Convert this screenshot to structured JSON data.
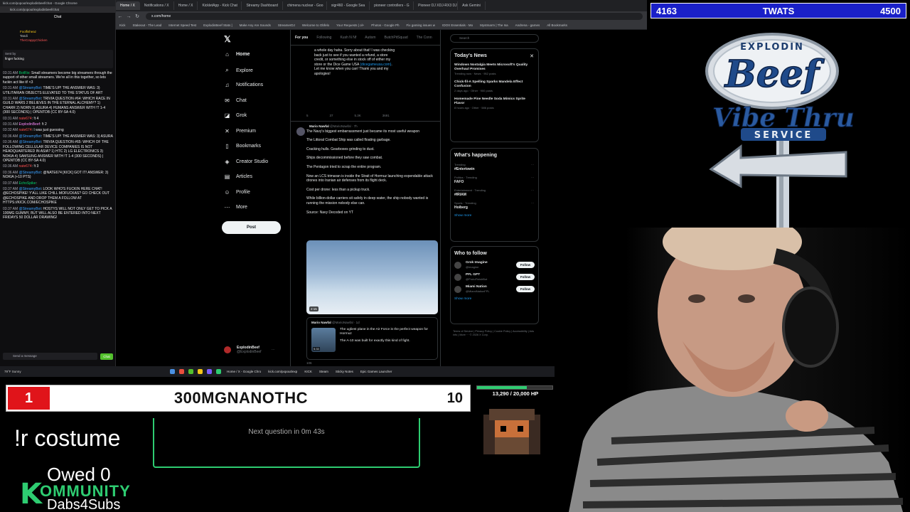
{
  "chat_window": {
    "title": "kick.com/popout/explodinbeef/chat - Google Chrome",
    "url": "kick.com/popout/explodinbeef/chat",
    "heading": "Chat",
    "leaderboard": [
      "Foolfisheaz",
      "Tandi",
      "TheCrappyChicken"
    ],
    "pinned_by": "Sent by",
    "pinned_text": "finger fucking",
    "messages": [
      {
        "time": "03:31 AM",
        "user": "BotRix",
        "text": "Small streamers become big streamers through the support of other small streamers. We're all in this together, so lets fuckin act like it! <3"
      },
      {
        "time": "03:31 AM",
        "user": "@StreamyBot",
        "text": "TIME'S UP! THE ANSWER WAS: 3) UTILITARIAN OBJECTS ELEVATED TO THE STATUS OF ART"
      },
      {
        "time": "03:31 AM",
        "user": "@StreamyBot",
        "text": "TRIVIA QUESTION #64: WHICH RACE IN GUILD WARS 2 BELIEVES IN THE ETERNAL ALCHEMY? 1) CHARR 2) NORN 3) ASURA 4) HUMANS ANSWER WITH !T 1-4 (300 SECONDS) | OPENTDB (CC BY-SA 4.0)"
      },
      {
        "time": "03:31 AM",
        "user": "nate674",
        "text": "!t 4"
      },
      {
        "time": "03:31 AM",
        "user": "ExplodinBeef",
        "text": "!t 2"
      },
      {
        "time": "03:32 AM",
        "user": "nate674",
        "text": "I was just guessing"
      },
      {
        "time": "03:36 AM",
        "user": "@StreamyBot",
        "text": "TIME'S UP! THE ANSWER WAS: 3) ASURA"
      },
      {
        "time": "03:36 AM",
        "user": "@StreamyBot",
        "text": "TRIVIA QUESTION #65: WHICH OF THE FOLLOWING CELLULAR DEVICE COMPANIES IS NOT HEADQUARTERED IN ASIA? 1) HTC 2) LG ELECTRONICS 3) NOKIA 4) SAMSUNG ANSWER WITH !T 1-4 (300 SECONDS) | OPENTDB (CC BY-SA 4.0)"
      },
      {
        "time": "03:36 AM",
        "user": "nate674",
        "text": "!t 3"
      },
      {
        "time": "03:36 AM",
        "user": "@StreamyBot",
        "text": "@NATE674 [KICK] GOT IT! ANSWER: 3) NOKIA (+10 PTS)"
      },
      {
        "time": "03:37 AM",
        "user": "EchoSpike",
        "text": ""
      },
      {
        "time": "03:37 AM",
        "user": "@StreamyBot",
        "text": "LOOK WHO'S FUCKIN HERE CHAT! @ECHOSPIKE! Y'ALL LIKE CHILL MOFUCKAS? GO CHECK OUT @ECHOSPIKE AND DROP THEM A FOLLOW AT HTTPS://KICK.COM/ECHOSPIKE"
      },
      {
        "time": "03:37 AM",
        "user": "@StreamyBot",
        "text": "HOSTYS WILL NOT ONLY GET TO PICK A 100MG GUMMY, BUT WILL ALSO BE ENTERED INTO NEXT FRIDAYS 50 DOLLAR DRAWING!"
      }
    ],
    "input_placeholder": "Send a message",
    "send_label": "Chat"
  },
  "browser": {
    "tabs": [
      "Home / X",
      "Notifications / X",
      "Home / X",
      "KickletApp - Kick Chat",
      "Streamy Dashboard",
      "chimena nuclear - Goo",
      "xigr460 - Google Sea",
      "pioneer controllers - G",
      "Pioneer DJ XDJ-RX3 DJ",
      "Ask Gemini"
    ],
    "url": "x.com/home",
    "bookmarks": [
      "Kick",
      "Stakeout - The Lead",
      "Internet Speed Test",
      "ExplodinBeef Stats |",
      "Make Any Are Sounds",
      "StreamerDJ",
      "Welcome to Obfelo",
      "Your Requests | ol+",
      "Photos - Google Ph",
      "Fix gaming issues w",
      "IDOX Essentials - Mo",
      "Mystmarm | The Isa",
      "Andrena - games",
      "All Bookmarks"
    ]
  },
  "x_nav": {
    "items": [
      {
        "label": "Home",
        "icon": "home-icon",
        "glyph": "⌂"
      },
      {
        "label": "Explore",
        "icon": "search-icon",
        "glyph": "⌕"
      },
      {
        "label": "Notifications",
        "icon": "bell-icon",
        "glyph": "♫"
      },
      {
        "label": "Chat",
        "icon": "chat-icon",
        "glyph": "✉"
      },
      {
        "label": "Grok",
        "icon": "grok-icon",
        "glyph": "◪"
      },
      {
        "label": "Premium",
        "icon": "x-premium-icon",
        "glyph": "✕"
      },
      {
        "label": "Bookmarks",
        "icon": "bookmark-icon",
        "glyph": "▯"
      },
      {
        "label": "Creator Studio",
        "icon": "creator-icon",
        "glyph": "◈"
      },
      {
        "label": "Articles",
        "icon": "articles-icon",
        "glyph": "▤"
      },
      {
        "label": "Profile",
        "icon": "profile-icon",
        "glyph": "☺"
      },
      {
        "label": "More",
        "icon": "more-icon",
        "glyph": "⋯"
      }
    ],
    "post_label": "Post",
    "account_name": "ExplodinBeef",
    "account_handle": "@ExplodinBeef"
  },
  "timeline": {
    "tabs": [
      "For you",
      "Following",
      "Kush N Nf",
      "Autism",
      "ButchPitSquad",
      "The Conn"
    ],
    "prev_text_a": "a whole day haha. Sorry about that! I was checking back just to see if you wanted a refund, a store credit, or something else in stock off of either my store or the Dice Game USA",
    "prev_link": "(dicegameusa.com)",
    "prev_text_b": ". Let me know when you can! Thank you and my apologies!",
    "prev_stats": [
      "5",
      "37",
      "5.3K",
      "3691"
    ],
    "tweet": {
      "author": "Mario Nawfal",
      "handle": "@MarioNawfal · 7h",
      "lines": [
        "The Navy's biggest embarrassment just became its most useful weapon",
        "The Littoral Combat Ship was called floating garbage.",
        "Cracking hulls. Gearboxes grinding to dust.",
        "Ships decommissioned before they saw combat.",
        "The Pentagon tried to scrap the entire program.",
        "Now an LCS trimaran is inside the Strait of Hormuz launching expendable attack drones into Iranian air defenses from its flight deck.",
        "Cost per drone: less than a pickup truck.",
        "While billion-dollar carriers sit safely in deep water, the ship nobody wanted is running the mission nobody else can.",
        "Source: Navy Decoded on YT"
      ],
      "video_duration": "2:15"
    },
    "quote": {
      "author": "Mario Nawfal",
      "handle": "@MarioNawfal · 1d",
      "text_a": "The ugliest plane in the Air Force is the perfect weapon for Hormuz",
      "text_b": "The A-10 was built for exactly this kind of fight.",
      "thumb_duration": "5:33"
    },
    "next_stats": [
      "106"
    ]
  },
  "right_col": {
    "search_placeholder": "Search",
    "news_title": "Today's News",
    "news": [
      {
        "title": "Windows Nostalgia Meets Microsoft's Quality Overhaul Promises",
        "meta": "Trending now · News · 952 posts"
      },
      {
        "title": "Chick-fil-A Spelling Sparks Mandela Effect Confusion",
        "meta": "2 days ago · Other · 900 posts"
      },
      {
        "title": "Homemade Pine Needle Soda Mimics Sprite Flavor",
        "meta": "8 hours ago · Other · 586 posts"
      }
    ],
    "happening_title": "What's happening",
    "trends": [
      {
        "context": "Trending",
        "name": "#Entertowin"
      },
      {
        "context": "Politics · Trending",
        "name": "FAFO"
      },
      {
        "context": "Entertainment · Trending",
        "name": "#IRIAM"
      },
      {
        "context": "Sports · Trending",
        "name": "Hoiberg"
      }
    ],
    "show_more": "Show more",
    "follow_title": "Who to follow",
    "follows": [
      {
        "name": "Grok Imagine",
        "handle": "@Imagine"
      },
      {
        "name": "PFL GPT",
        "handle": "@ProtoFinishBot"
      },
      {
        "name": "Miami Nation",
        "handle": "@MiamiNationFPL"
      }
    ],
    "follow_label": "Follow",
    "footer": "Terms of Service | Privacy Policy | Cookie Policy | Accessibility | Ads info | More ··· © 2026 X Corp."
  },
  "taskbar": {
    "weather": "79°F Sunny",
    "apps": [
      "Home / X - Google Chro",
      "kick.com/popout/exp",
      "KICK",
      "Steam",
      "Sticky Notes",
      "Epic Games Launcher"
    ],
    "time": "3:42 AM",
    "date": "3/22/2026"
  },
  "overlay": {
    "score_left": "4163",
    "score_center": "TWATS",
    "score_right": "4500",
    "logo_top": "EXPLODIN",
    "logo_mid": "Beef",
    "logo_vibe": "Vibe Thru",
    "logo_service": "SERVICE",
    "question_number": "1",
    "question_answer": "300MGNANOTHC",
    "question_timer": "10",
    "hp_text": "13,290 / 20,000 HP",
    "hp_fraction": 0.66,
    "next_question": "Next question in 0m 43s",
    "command": "!r costume",
    "owed": "Owed 0",
    "kommunity_k": "K",
    "kommunity_word": "OMMUNITY",
    "dabs": "Dabs4Subs"
  },
  "colors": {
    "score_bg": "#1a20c8",
    "question_red": "#e0141a",
    "accent_green": "#2ecc71",
    "x_blue": "#1d9bf0"
  }
}
